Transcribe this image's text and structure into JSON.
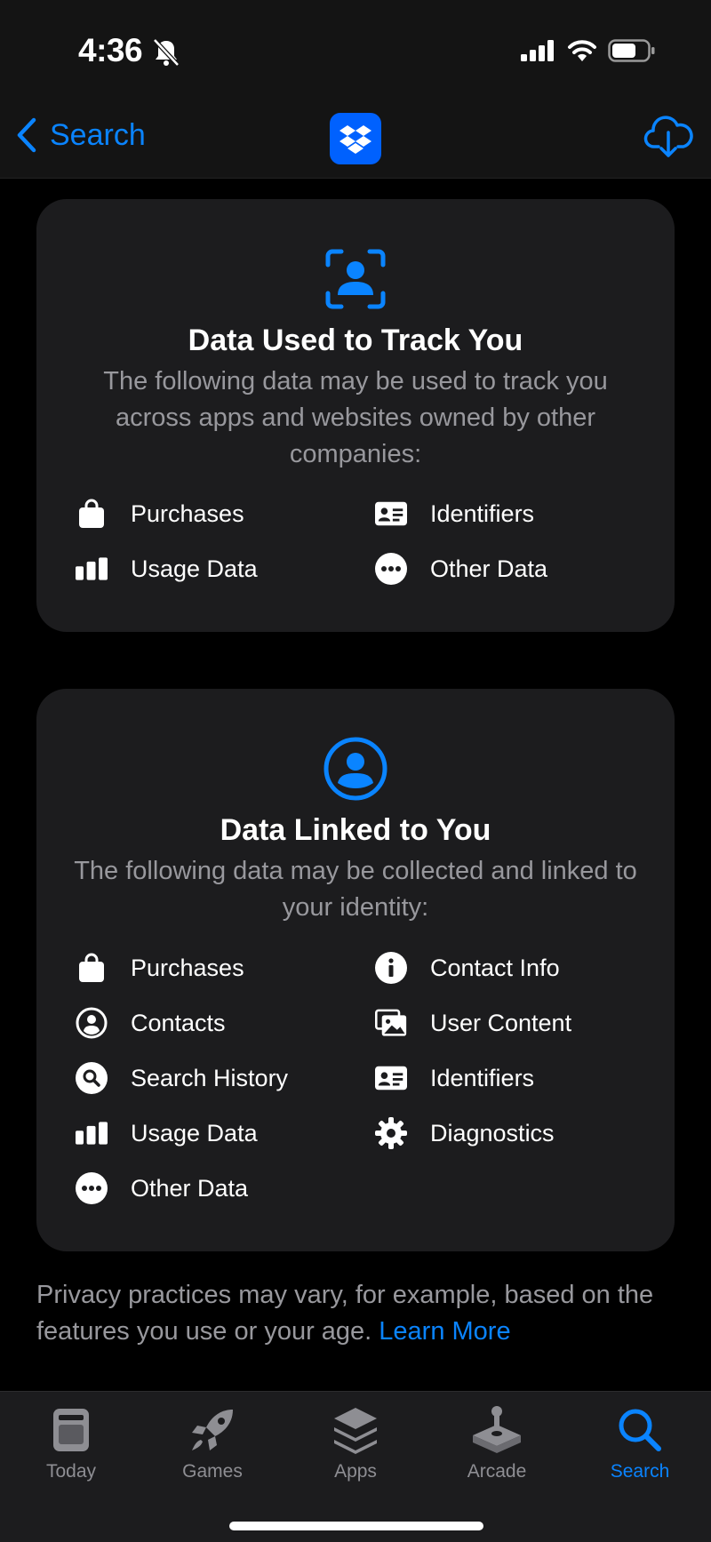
{
  "status": {
    "time": "4:36"
  },
  "nav": {
    "back_label": "Search"
  },
  "track_card": {
    "title": "Data Used to Track You",
    "description": "The following data may be used to track you across apps and websites owned by other companies:",
    "items": [
      {
        "label": "Purchases",
        "icon": "shopping-bag-icon"
      },
      {
        "label": "Identifiers",
        "icon": "id-card-icon"
      },
      {
        "label": "Usage Data",
        "icon": "bar-chart-icon"
      },
      {
        "label": "Other Data",
        "icon": "ellipsis-circle-icon"
      }
    ]
  },
  "linked_card": {
    "title": "Data Linked to You",
    "description": "The following data may be collected and linked to your identity:",
    "items": [
      {
        "label": "Purchases",
        "icon": "shopping-bag-icon"
      },
      {
        "label": "Contact Info",
        "icon": "info-circle-icon"
      },
      {
        "label": "Contacts",
        "icon": "person-circle-icon"
      },
      {
        "label": "User Content",
        "icon": "photos-icon"
      },
      {
        "label": "Search History",
        "icon": "magnifier-circle-icon"
      },
      {
        "label": "Identifiers",
        "icon": "id-card-icon"
      },
      {
        "label": "Usage Data",
        "icon": "bar-chart-icon"
      },
      {
        "label": "Diagnostics",
        "icon": "gear-icon"
      },
      {
        "label": "Other Data",
        "icon": "ellipsis-circle-icon"
      }
    ]
  },
  "footer": {
    "note": "Privacy practices may vary, for example, based on the features you use or your age.",
    "link": "Learn More"
  },
  "tabs": [
    {
      "label": "Today",
      "icon": "today-icon",
      "active": false
    },
    {
      "label": "Games",
      "icon": "rocket-icon",
      "active": false
    },
    {
      "label": "Apps",
      "icon": "stack-icon",
      "active": false
    },
    {
      "label": "Arcade",
      "icon": "joystick-icon",
      "active": false
    },
    {
      "label": "Search",
      "icon": "search-icon",
      "active": true
    }
  ],
  "colors": {
    "accent": "#0a84ff",
    "card_bg": "#1c1c1e",
    "secondary_text": "#98989d",
    "dropbox_blue": "#0061fe"
  }
}
